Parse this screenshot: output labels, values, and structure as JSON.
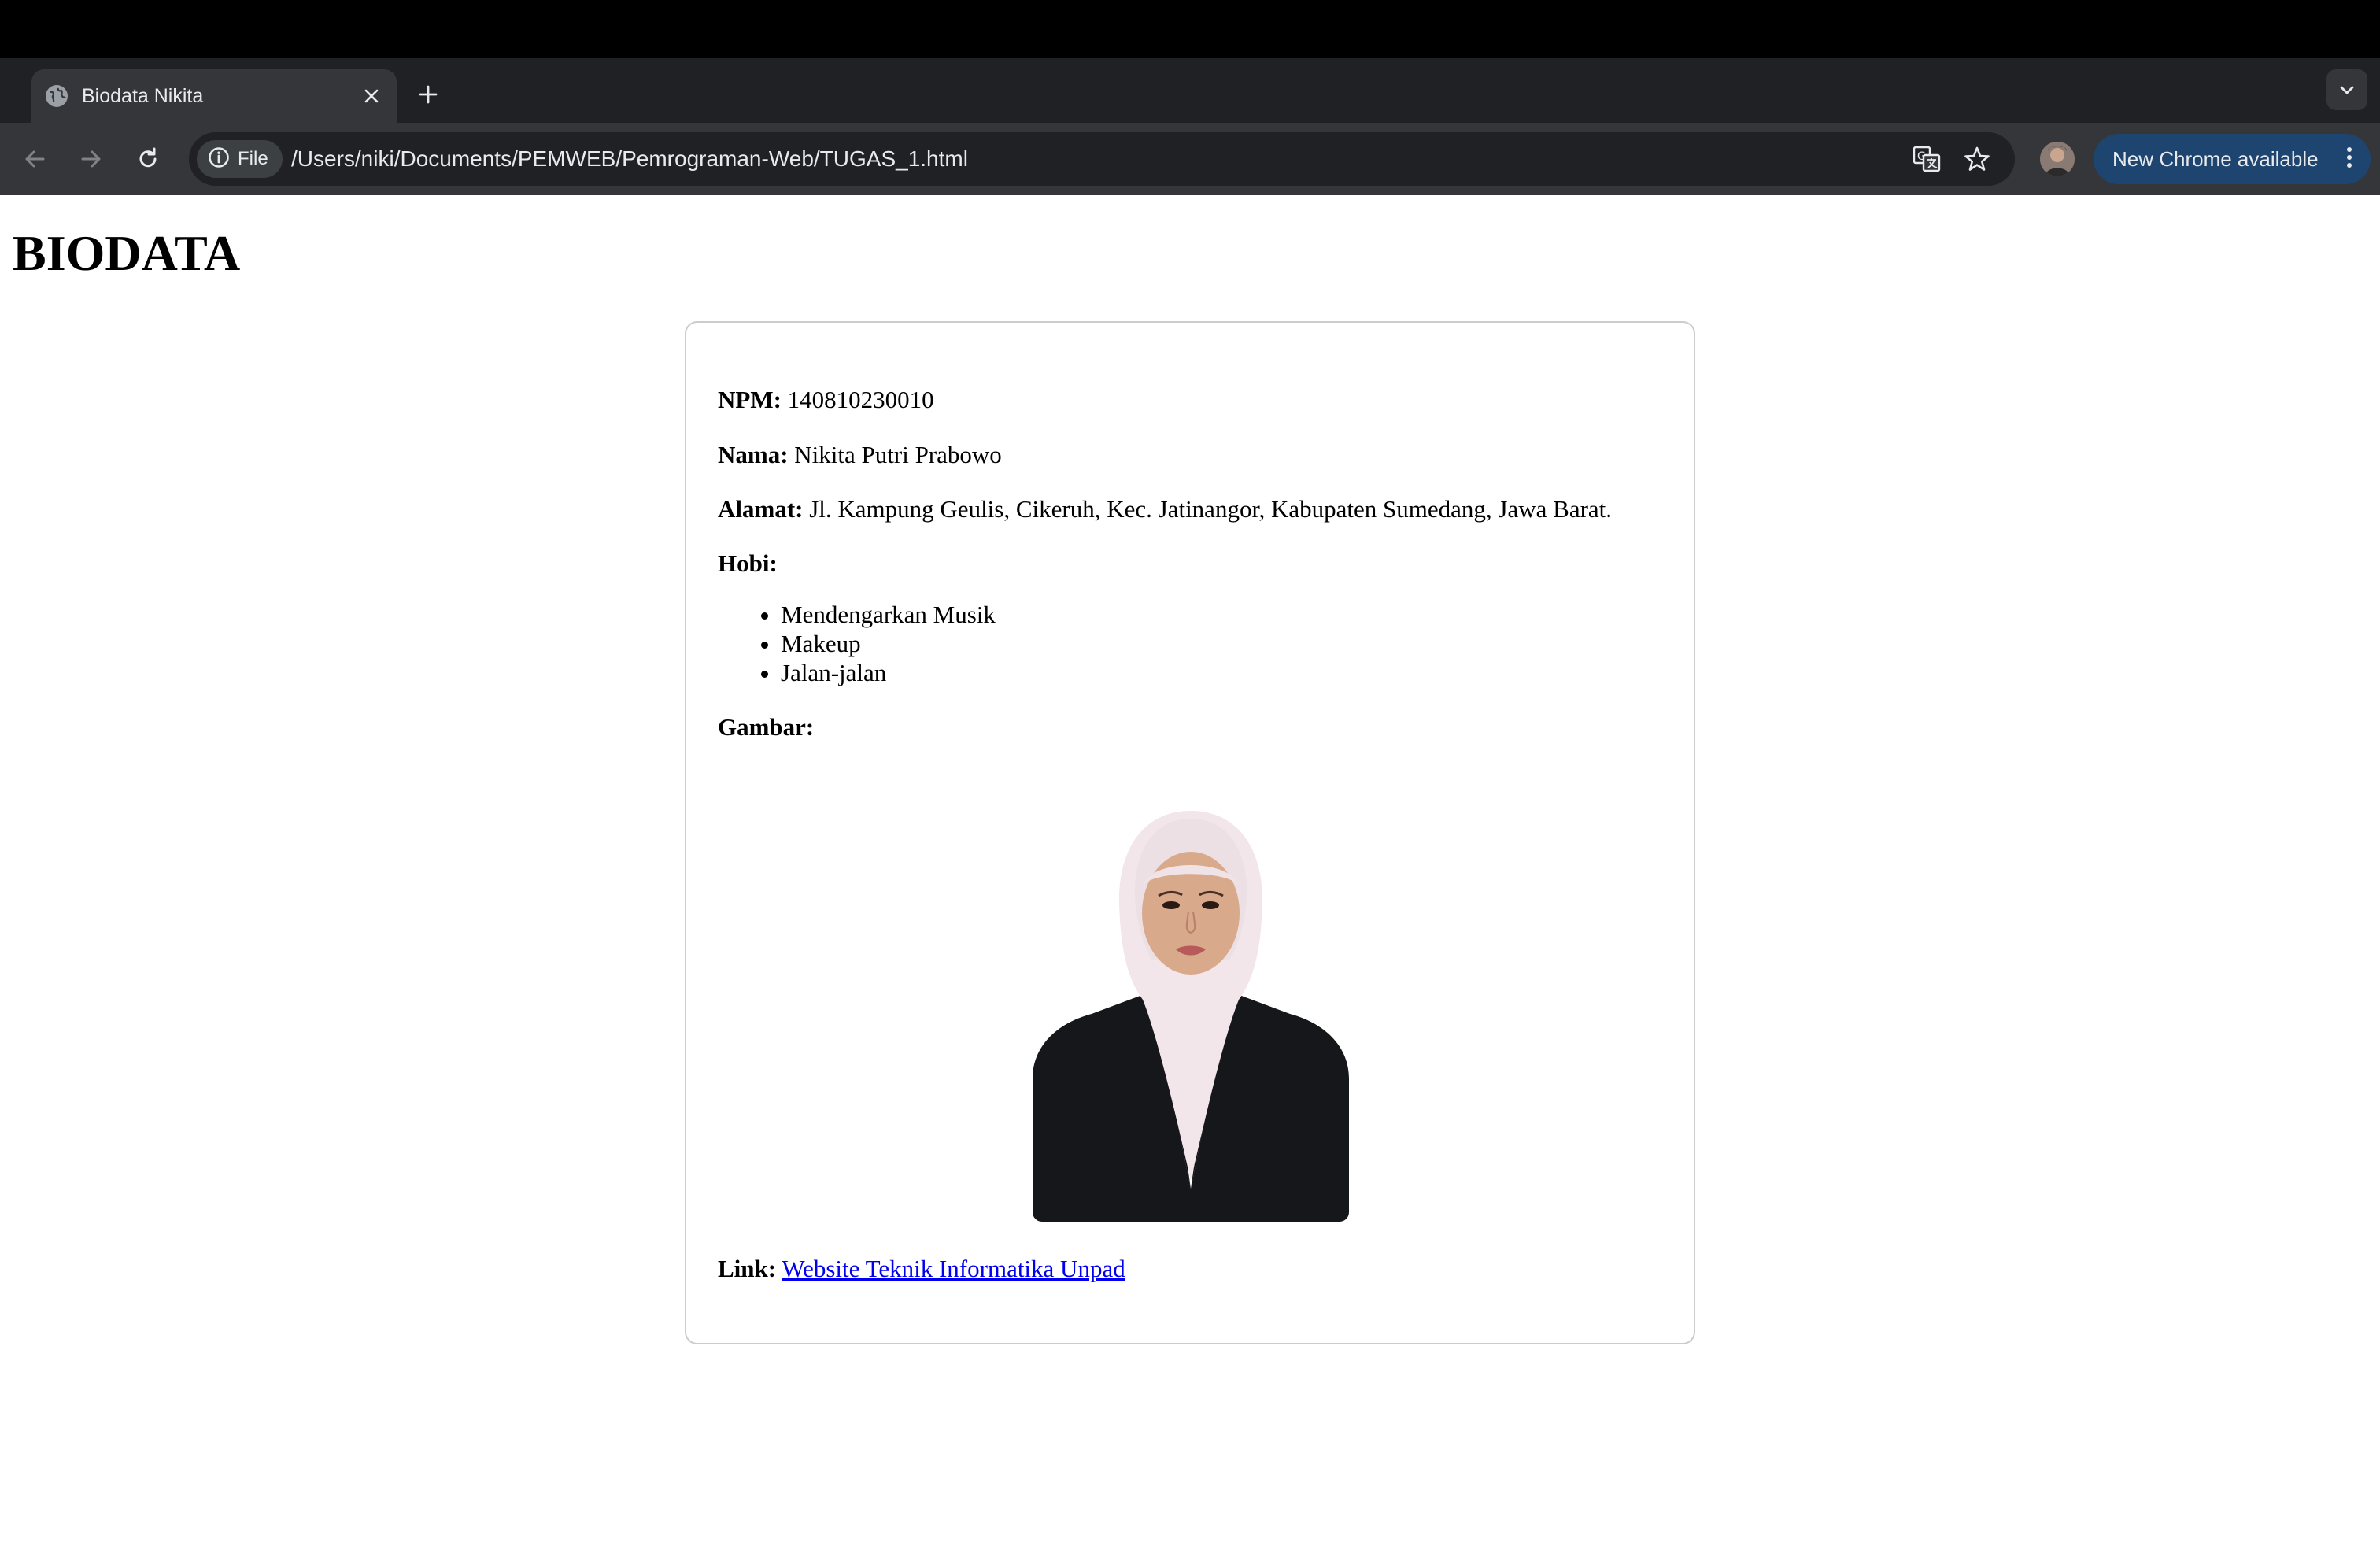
{
  "browser": {
    "tab_title": "Biodata Nikita",
    "address_chip": "File",
    "url": "/Users/niki/Documents/PEMWEB/Pemrograman-Web/TUGAS_1.html",
    "update_button": "New Chrome available"
  },
  "page": {
    "title": "BIODATA",
    "npm": {
      "label": "NPM:",
      "value": "140810230010"
    },
    "nama": {
      "label": "Nama:",
      "value": "Nikita Putri Prabowo"
    },
    "alamat": {
      "label": "Alamat:",
      "value": "Jl. Kampung Geulis, Cikeruh, Kec. Jatinangor, Kabupaten Sumedang, Jawa Barat."
    },
    "hobi": {
      "label": "Hobi:",
      "items": [
        "Mendengarkan Musik",
        "Makeup",
        "Jalan-jalan"
      ]
    },
    "gambar": {
      "label": "Gambar:"
    },
    "link": {
      "label": "Link:",
      "text": "Website Teknik Informatika Unpad"
    }
  },
  "colors": {
    "link": "#0000ee",
    "update_pill": "#1e4570",
    "toolbar": "#35363a",
    "tabstrip": "#202124"
  },
  "icons": [
    "globe-icon",
    "close-icon",
    "plus-icon",
    "chevron-down-icon",
    "back-arrow-icon",
    "forward-arrow-icon",
    "reload-icon",
    "info-icon",
    "translate-icon",
    "star-icon",
    "kebab-menu-icon"
  ]
}
